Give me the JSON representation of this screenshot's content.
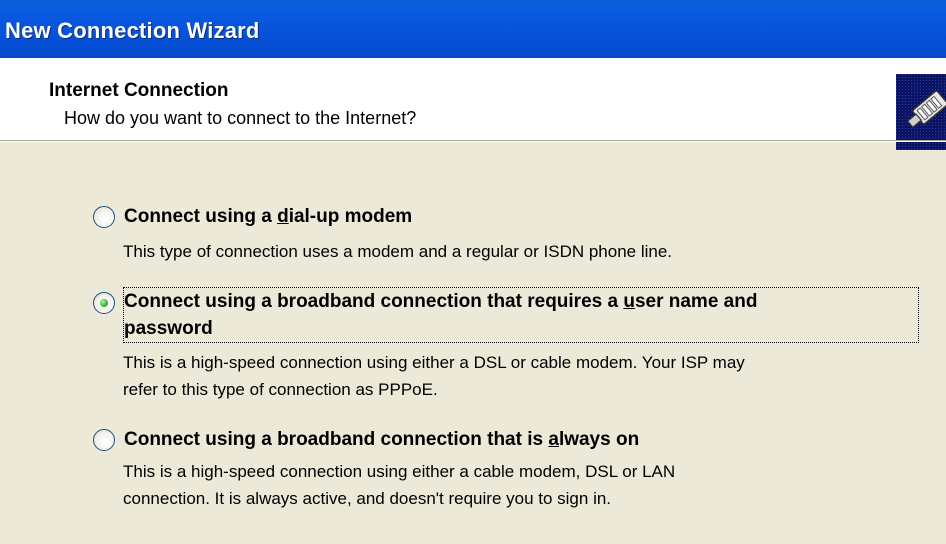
{
  "window": {
    "title": "New Connection Wizard"
  },
  "header": {
    "heading": "Internet Connection",
    "subheading": "How do you want to connect to the Internet?",
    "icon": "network-cable-icon"
  },
  "options": [
    {
      "label_pre": "Connect using a ",
      "label_accel": "d",
      "label_post": "ial-up modem",
      "description": "This type of connection uses a modem and a regular or ISDN phone line.",
      "selected": false
    },
    {
      "label_line1_pre": "Connect using a broadband connection that requires a ",
      "label_accel": "u",
      "label_line1_post": "ser name and",
      "label_line2": "password",
      "description_line1": "This is a high-speed connection using either a DSL or cable modem. Your ISP may",
      "description_line2": "refer to this type of connection as PPPoE.",
      "selected": true
    },
    {
      "label_pre": "Connect using a broadband connection that is ",
      "label_accel": "a",
      "label_post": "lways on",
      "description_line1": "This is a high-speed connection using either a cable modem, DSL or LAN",
      "description_line2": "connection. It is always active, and doesn't require you to sign in.",
      "selected": false
    }
  ],
  "colors": {
    "titlebar": "#0855dd",
    "dialog_bg": "#ece9d8",
    "header_bg": "#ffffff",
    "radio_selected_dot": "#3bb02a"
  }
}
